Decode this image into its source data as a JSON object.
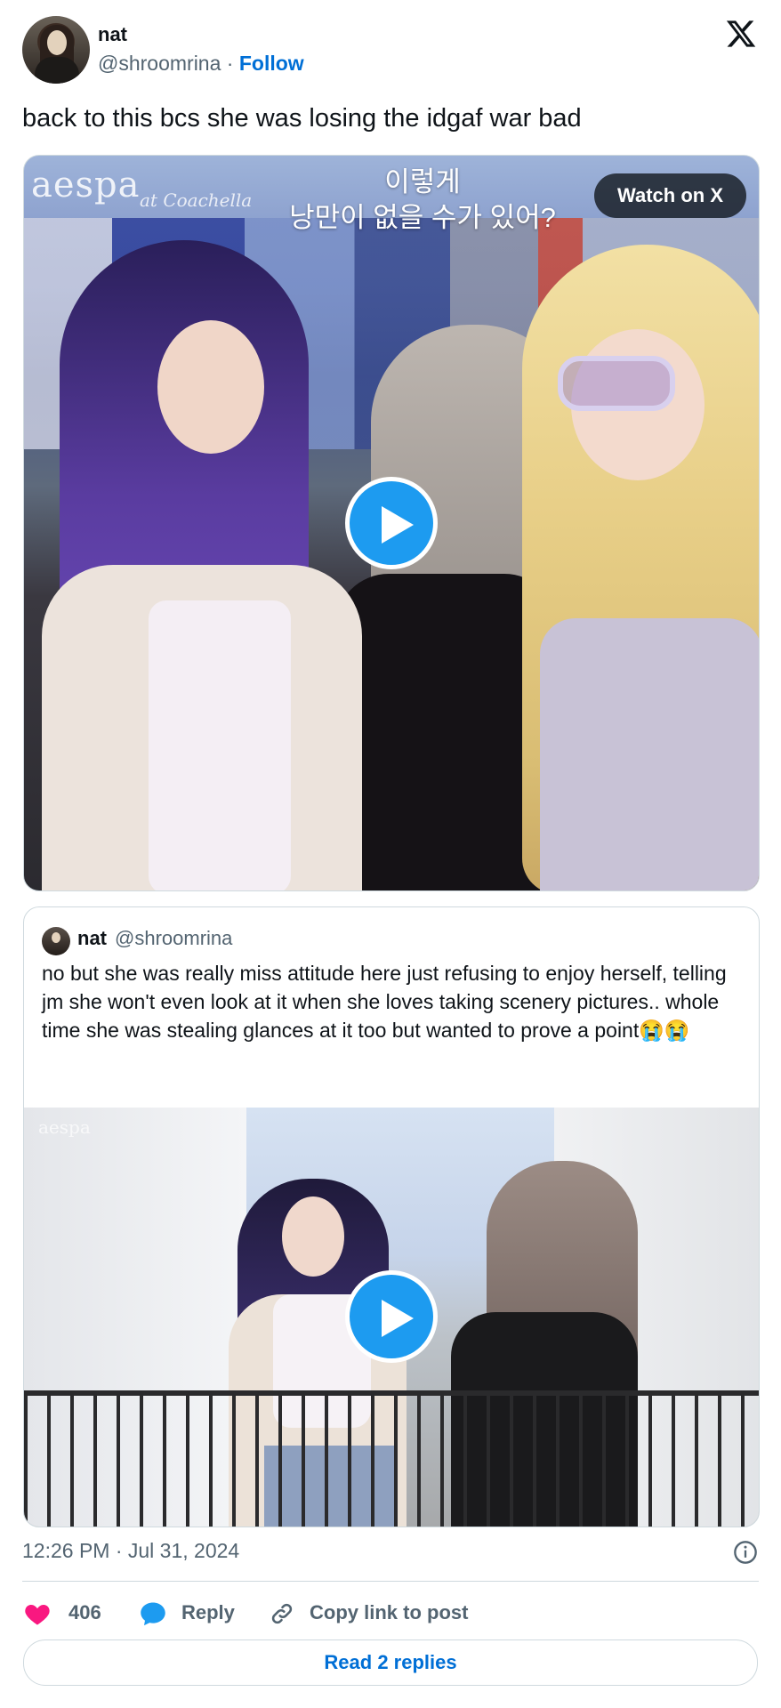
{
  "author": {
    "display_name": "nat",
    "handle": "@shroomrina",
    "separator": "·",
    "follow_label": "Follow"
  },
  "tweet": {
    "text": "back to this bcs she was losing the idgaf war bad"
  },
  "media": {
    "watch_label": "Watch on X",
    "overlay_brand": "aespa",
    "overlay_brand_sub": "at Coachella",
    "overlay_caption_line1": "이렇게",
    "overlay_caption_line2": "낭만이 없을 수가 있어?"
  },
  "quote": {
    "display_name": "nat",
    "handle": "@shroomrina",
    "text": "no but she was really miss attitude here just refusing to enjoy herself, telling jm she won't even look at it when she loves taking scenery pictures.. whole time she was stealing glances at it too but wanted to prove a point😭😭",
    "media_brand": "aespa"
  },
  "footer": {
    "timestamp": "12:26 PM · Jul 31, 2024",
    "like_count": "406",
    "reply_label": "Reply",
    "copy_link_label": "Copy link to post",
    "read_replies_label": "Read 2 replies"
  },
  "colors": {
    "accent": "#1d9bf0",
    "link": "#006fd6",
    "like": "#f91880",
    "muted_text": "#536471",
    "border": "#cfd9de"
  },
  "icons": [
    "x-logo-icon",
    "play-icon",
    "heart-icon",
    "reply-bubble-icon",
    "link-icon",
    "info-icon"
  ]
}
